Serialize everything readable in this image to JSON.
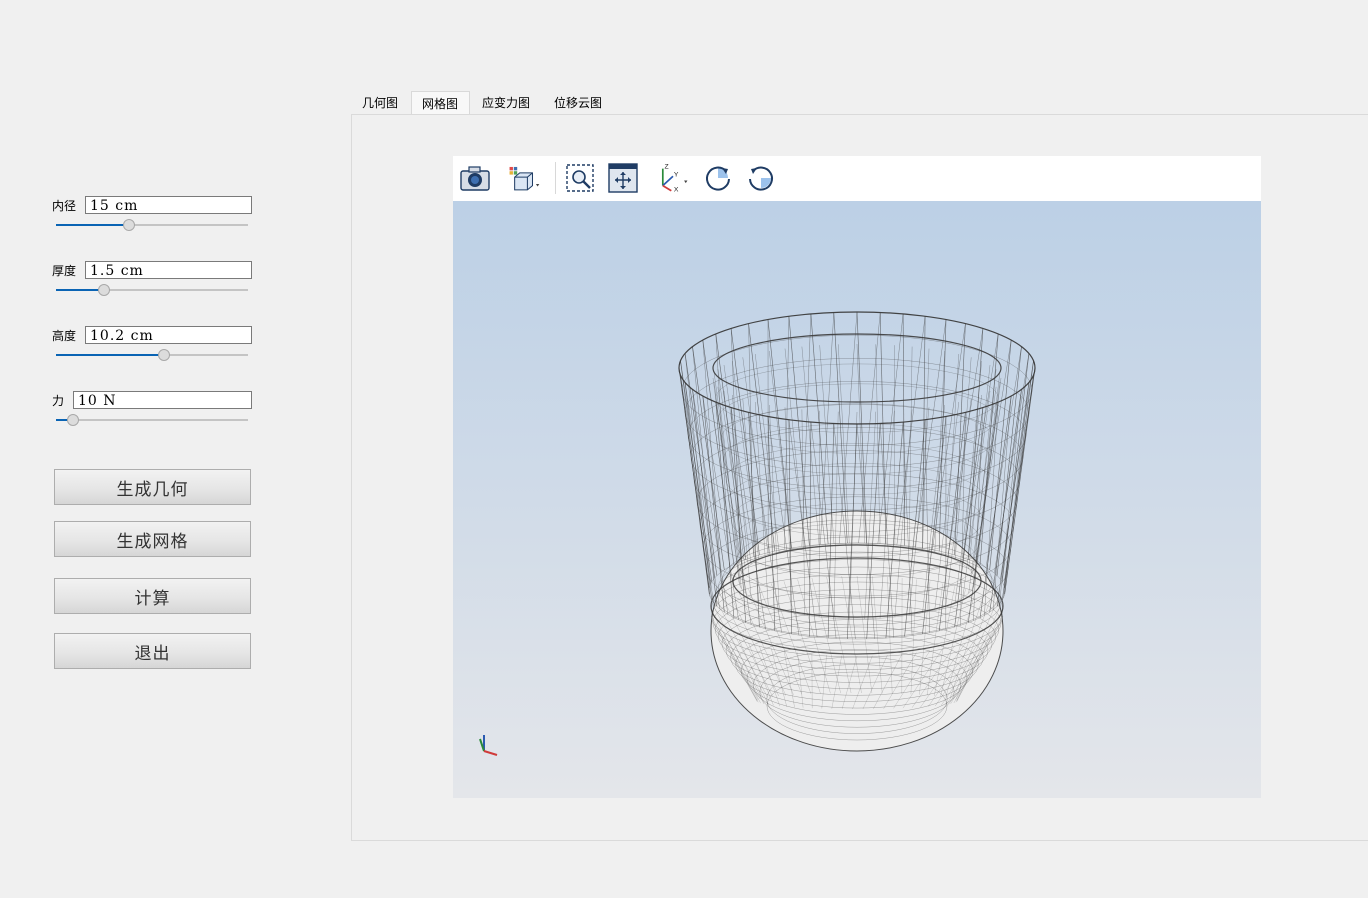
{
  "params": [
    {
      "label": "内径",
      "value": "15 cm",
      "slider": 0.38
    },
    {
      "label": "厚度",
      "value": "1.5 cm",
      "slider": 0.25
    },
    {
      "label": "高度",
      "value": "10.2 cm",
      "slider": 0.56
    },
    {
      "label": "力",
      "value": "10 N",
      "slider": 0.09
    }
  ],
  "buttons": {
    "gen_geometry": "生成几何",
    "gen_mesh": "生成网格",
    "compute": "计算",
    "exit": "退出"
  },
  "tabs": [
    {
      "label": "几何图",
      "active": false
    },
    {
      "label": "网格图",
      "active": true
    },
    {
      "label": "应变力图",
      "active": false
    },
    {
      "label": "位移云图",
      "active": false
    }
  ],
  "toolbar": {
    "items": [
      "camera-icon",
      "view-cube-icon",
      "zoom-box-icon",
      "fit-all-icon",
      "axes-orientation-icon",
      "rotate-cw-icon",
      "rotate-ccw-icon"
    ],
    "accent": "#1f5a9a"
  },
  "viewer": {
    "bg_top": "#bcd0e6",
    "bg_bottom": "#e4e6ea",
    "mesh_color": "#3a3a3a"
  }
}
